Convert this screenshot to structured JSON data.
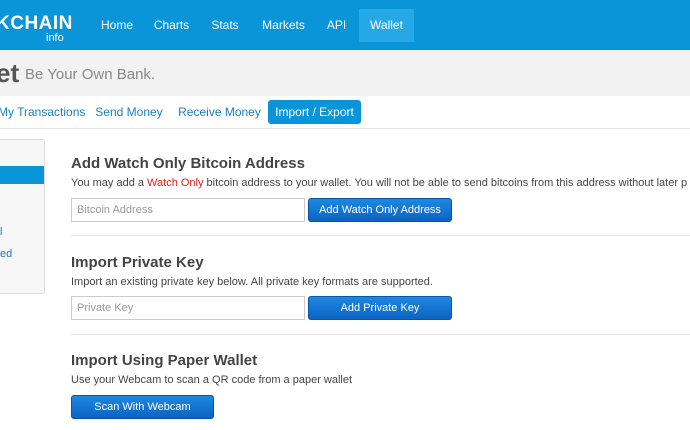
{
  "brand": {
    "logo_text": "KCHAIN",
    "logo_sub": "info"
  },
  "nav": {
    "items": [
      {
        "label": "Home"
      },
      {
        "label": "Charts"
      },
      {
        "label": "Stats"
      },
      {
        "label": "Markets"
      },
      {
        "label": "API"
      },
      {
        "label": "Wallet"
      }
    ],
    "active": "Wallet"
  },
  "header": {
    "title": "et",
    "tagline": "Be Your Own Bank."
  },
  "subnav": {
    "tabs": [
      {
        "label": "My Transactions"
      },
      {
        "label": "Send Money"
      },
      {
        "label": "Receive Money"
      },
      {
        "label": "Import / Export"
      }
    ],
    "active": "Import / Export"
  },
  "sidebar": {
    "links": [
      {
        "label": "l"
      },
      {
        "label": "ed"
      }
    ]
  },
  "sections": {
    "watch_only": {
      "title": "Add Watch Only Bitcoin Address",
      "desc_before": "You may add a ",
      "desc_highlight": "Watch Only",
      "desc_after": " bitcoin address to your wallet. You will not be able to send bitcoins from this address without later p",
      "input_placeholder": "Bitcoin Address",
      "button_label": "Add Watch Only Address"
    },
    "private_key": {
      "title": "Import Private Key",
      "desc": "Import an existing private key below. All private key formats are supported.",
      "input_placeholder": "Private Key",
      "button_label": "Add Private Key"
    },
    "paper_wallet": {
      "title": "Import Using Paper Wallet",
      "desc": "Use your Webcam to scan a QR code from a paper wallet",
      "button_label": "Scan With Webcam"
    }
  },
  "colors": {
    "brand_blue": "#0a95d8",
    "button_blue": "#0c63c4",
    "highlight_red": "#e02020"
  }
}
